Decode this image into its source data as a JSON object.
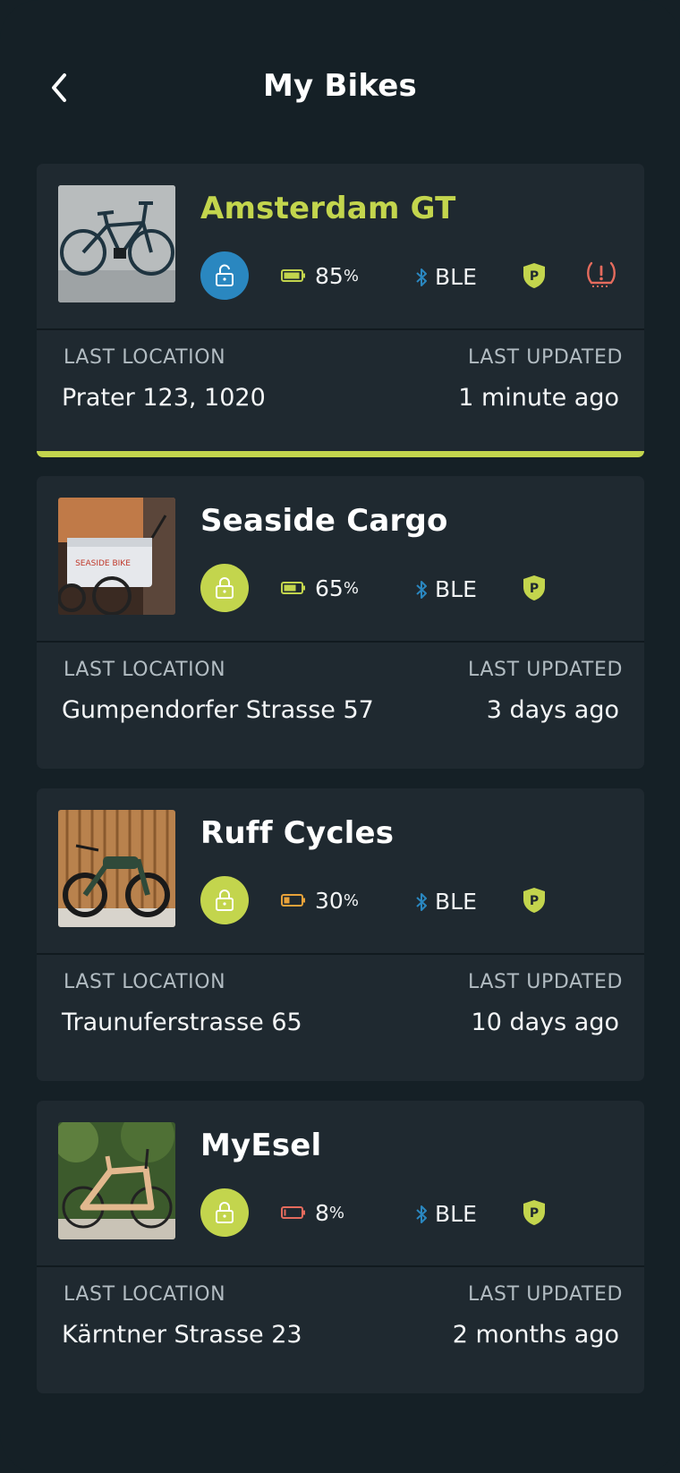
{
  "header": {
    "title": "My Bikes"
  },
  "labels": {
    "location": "LAST LOCATION",
    "updated": "LAST UPDATED"
  },
  "colors": {
    "accent": "#c3d54d",
    "unlocked": "#2a87c0",
    "bluetooth": "#2a87c0",
    "alert": "#e56b5d",
    "battery_low": "#e8a23a"
  },
  "bikes": [
    {
      "name": "Amsterdam GT",
      "battery_value": "85",
      "battery_unit": "%",
      "battery_level": 0.85,
      "lock_state": "unlocked",
      "connection": "BLE",
      "alert_icon": "tire-pressure-warning-icon",
      "location": "Prater 123, 1020",
      "updated": "1 minute ago",
      "selected": true
    },
    {
      "name": "Seaside Cargo",
      "battery_value": "65",
      "battery_unit": "%",
      "battery_level": 0.65,
      "lock_state": "locked",
      "connection": "BLE",
      "location": "Gumpendorfer Strasse 57",
      "updated": "3 days ago"
    },
    {
      "name": "Ruff Cycles",
      "battery_value": "30",
      "battery_unit": "%",
      "battery_level": 0.3,
      "lock_state": "locked",
      "connection": "BLE",
      "location": "Traunuferstrasse 65",
      "updated": "10 days ago"
    },
    {
      "name": "MyEsel",
      "battery_value": "8",
      "battery_unit": "%",
      "battery_level": 0.08,
      "lock_state": "locked",
      "connection": "BLE",
      "location": "Kärntner Strasse 23",
      "updated": "2 months ago"
    }
  ]
}
